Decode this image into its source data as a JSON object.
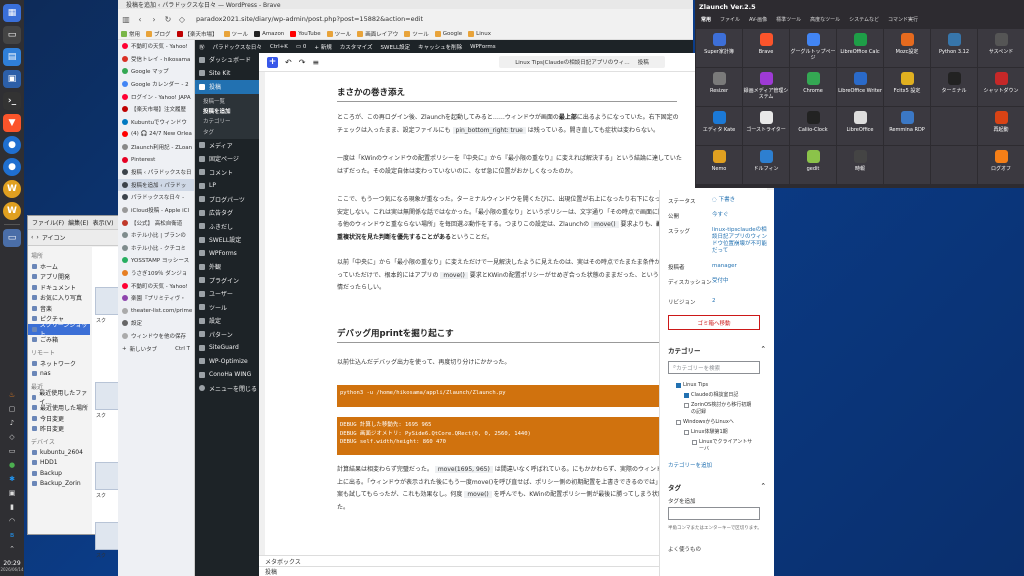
{
  "dock": {
    "clock_time": "20:29",
    "clock_date": "2026/06/14"
  },
  "file_manager": {
    "menu": [
      "ファイル(F)",
      "編集(E)",
      "表示(V)"
    ],
    "toolbar_label": "アイコン",
    "places_header": "場所",
    "places": [
      "ホーム",
      "アプリ開発",
      "ドキュメント",
      "お気に入り写真",
      "音楽",
      "ピクチャ",
      "スクリーンショット",
      "ごみ箱"
    ],
    "remote_header": "リモート",
    "remote": [
      "ネットワーク",
      "nas"
    ],
    "recent_header": "最近",
    "recent": [
      "最近使用したファイ...",
      "最近使用した場所",
      "今日変更",
      "昨日変更"
    ],
    "devices_header": "デバイス",
    "devices": [
      "kubuntu_2604",
      "HDD1",
      "Backup",
      "Backup_Zorin"
    ],
    "file_labels": [
      "スク",
      "スク",
      "スク",
      "スク"
    ]
  },
  "browser": {
    "window_title": "投稿を追加 ‹ パラドックスな日々 — WordPress - Brave",
    "url": "paradox2021.site/diary/wp-admin/post.php?post=15882&action=edit",
    "bookmarks": [
      "常用",
      "ブログ",
      "【楽天市場】",
      "ツール",
      "Amazon",
      "YouTube",
      "ツール",
      "画面レイアウ",
      "ツール",
      "Google",
      "Linux"
    ],
    "tabs": [
      "不動町の天気 - Yahoo!",
      "受信トレイ - hikosama",
      "Google マップ",
      "Google カレンダー - 2",
      "ログイン - Yahoo! JAPA",
      "【楽天市場】注文履歴",
      "Kubuntuでウィンドウ",
      "(4) 🎧 24/7 New Orlea",
      "Zlaunch利用記 - ZLoan",
      "Pinterest",
      "投稿 ‹ パラドックスな日",
      "投稿を追加 ‹ パラドッ",
      "パラドックスな日々 -",
      "iCloud投稿 - Apple iCl",
      "【公式】 高松自衛道",
      "ホテル小比 | ブランの",
      "ホテル小比 - クチコミ",
      "YOSSTAMP ヨッシース",
      "うさぎ109％ ダンジョ",
      "不動町の天気 - Yahoo!",
      "楽園『プリミティヴ・",
      "theater-list.com/prime",
      "設定",
      "ウィンドウを他の保存",
      "新しいタブ"
    ],
    "new_tab_shortcut": "Ctrl T"
  },
  "wp_admin_bar": {
    "items": [
      "パラドックスな日々",
      "Ctrl+K",
      "0",
      "新規",
      "カスタマイズ",
      "SWELL設定",
      "キャッシュを削除",
      "WPForms"
    ]
  },
  "wp_menu": {
    "items": [
      "ダッシュボード",
      "Site Kit",
      "投稿"
    ],
    "submenu": [
      "投稿一覧",
      "投稿を追加",
      "カテゴリー",
      "タグ"
    ],
    "items2": [
      "メディア",
      "固定ページ",
      "コメント",
      "LP",
      "ブログパーツ",
      "広告タグ",
      "ふきだし",
      "SWELL設定",
      "WPForms",
      "外観",
      "プラグイン",
      "ユーザー",
      "ツール",
      "設定",
      "パターン",
      "SiteGuard",
      "WP-Optimize",
      "ConoHa WING",
      "メニューを閉じる"
    ]
  },
  "editor": {
    "doc_title": "Linux Tips|Claudeの相談日記アプリのウィ…",
    "doc_type": "投稿",
    "h1": "まさかの巻き添え",
    "p1a": "ところが、この再ログイン後、Zlaunchを起動してみると……ウィンドウが画面の",
    "p1b": "最上部",
    "p1c": "に出るようになっていた。右下固定のチェックは入ったまま、設定ファイルにも",
    "p1code": "pin_bottom_right: true",
    "p1d": "は残っている。開き直しても症状は変わらない。",
    "p2": "一度は「KWinのウィンドウの配置ポリシーを『中央に』から『最小限の重なり』に変えれば解決する」という結論に達していたはずだった。その設定自体は変わっていないのに、なぜ急に位置がおかしくなったのか。",
    "p3a": "ここで、もう一つ気になる現象が重なった。ターミナルウィンドウを開くたびに、出現位置が右上になったり右下になったりと安定しない。これは実は無関係な話ではなかった。「最小限の重なり」というポリシーは、文字通り「その時点で画面に開いている他のウィンドウと重ならない場所」を毎回選ぶ動作をする。つまりこの設定は、Zlaunchの",
    "p3code": "move()",
    "p3b": "要求よりも、",
    "p3bold": "画面上の重複状況を見た判断を優先することがある",
    "p3c": "ということだ。",
    "p4a": "以前「中央に」から「最小限の重なり」に変えただけで一見解決したように見えたのは、実はその時点でたまたま条件が噛み合っていただけで、根本的にはアプリの",
    "p4code": "move()",
    "p4b": "要求とKWinの配置ポリシーがせめぎ合った状態のままだった、というのが実情だったらしい。",
    "h2": "デバッグ用printを掘り起こす",
    "p5": "以前仕込んだデバッグ出力を使って、再度切り分けにかかった。",
    "code1": "python3 -u /home/hikosama/appli/Zlaunch/Zlaunch.py",
    "code2a": "DEBUG 計算した移動先: 1695 965",
    "code2b": "DEBUG 画面ジオメトリ: PySide6.QtCore.QRect(0, 0, 2560, 1440)",
    "code2c": "DEBUG self.width/height: 860 470",
    "p6a": "計算結果は相変わらず完璧だった。",
    "p6code": "move(1695, 965)",
    "p6b": "は間違いなく呼ばれている。にもかかわらず、実際のウィンドウは右上に出る。「ウィンドウが表示された後にもう一度move()を呼び直せば、ポリシー側の初期配置を上書きできるのでは」という案も試してもらったが、これも効果なし。何度",
    "p6code2": "move()",
    "p6c": "を呼んでも、KWinの配置ポリシー側が最後に勝ってしまう状態だった。",
    "metabox": "メタボックス",
    "postbar": "投稿"
  },
  "settings_sidebar": {
    "status_label": "ステータス",
    "status_value": "下書き",
    "publish_label": "公開",
    "publish_value": "今すぐ",
    "slug_label": "スラッグ",
    "slug_value": "linux-tipsclaudeの相談日記アプリのウィンドウ位置崩壊が不可能だって",
    "author_label": "投稿者",
    "author_value": "manager",
    "discussion_label": "ディスカッション",
    "discussion_value": "受付中",
    "revision_label": "リビジョン",
    "revision_value": "2",
    "trash": "ゴミ箱へ移動",
    "category_header": "カテゴリー",
    "category_search": "カテゴリーを検索",
    "categories": [
      {
        "label": "Linux Tips",
        "checked": true
      },
      {
        "label": "Claudeの相談室日記",
        "checked": true
      },
      {
        "label": "ZorinOS検討から移行初期の記録",
        "checked": false
      },
      {
        "label": "WindowsからLinuxへ",
        "checked": false
      },
      {
        "label": "Linux体験第1期",
        "checked": false
      },
      {
        "label": "Linuxでクライアントサーバ",
        "checked": false
      }
    ],
    "add_category": "カテゴリーを追加",
    "tag_header": "タグ",
    "tag_add_label": "タグを追加",
    "tag_hint": "半角コンマまたはエンターキーで区切ります。",
    "tag_frequent": "よく使うもの"
  },
  "zlaunch": {
    "title": "Zlaunch Ver.2.5",
    "tabs": [
      "常用",
      "ファイル",
      "AV-画像",
      "標準ツール",
      "高度なツール",
      "システムなど",
      "コマンド実行"
    ],
    "apps": [
      {
        "label": "Super家計簿",
        "color": "#3d6fd8"
      },
      {
        "label": "Brave",
        "color": "#fb542b"
      },
      {
        "label": "グーグルトップページ",
        "color": "#4285f4"
      },
      {
        "label": "LibreOffice Calc",
        "color": "#1e9e47"
      },
      {
        "label": "Mozc設定",
        "color": "#e56a1e"
      },
      {
        "label": "Python 3.12",
        "color": "#3776ab"
      },
      {
        "label": "サスペンド",
        "color": "#555555"
      },
      {
        "label": "Resizer",
        "color": "#7a7a7a"
      },
      {
        "label": "録画メディア管理システム",
        "color": "#9e3ad6"
      },
      {
        "label": "Chrome",
        "color": "#34a853"
      },
      {
        "label": "LibreOffice Writer",
        "color": "#2a6ac9"
      },
      {
        "label": "Fcitx5 設定",
        "color": "#e0b020"
      },
      {
        "label": "ターミナル",
        "color": "#222222"
      },
      {
        "label": "シャットダウン",
        "color": "#c62828"
      },
      {
        "label": "エディタ Kate",
        "color": "#1b79d6"
      },
      {
        "label": "ゴーストライター",
        "color": "#e8e8e8"
      },
      {
        "label": "Caliio-Clock",
        "color": "#222222"
      },
      {
        "label": "LibreOffice",
        "color": "#dddddd"
      },
      {
        "label": "Remmina RDP",
        "color": "#3b78c5"
      },
      {
        "label": "",
        "color": ""
      },
      {
        "label": "再起動",
        "color": "#d84315"
      },
      {
        "label": "Nemo",
        "color": "#e0a020"
      },
      {
        "label": "ドルフィン",
        "color": "#2d7fd0"
      },
      {
        "label": "gedit",
        "color": "#8bc34a"
      },
      {
        "label": "時報",
        "color": "#444444"
      },
      {
        "label": "",
        "color": ""
      },
      {
        "label": "",
        "color": ""
      },
      {
        "label": "ログオフ",
        "color": "#f57f17"
      }
    ]
  }
}
